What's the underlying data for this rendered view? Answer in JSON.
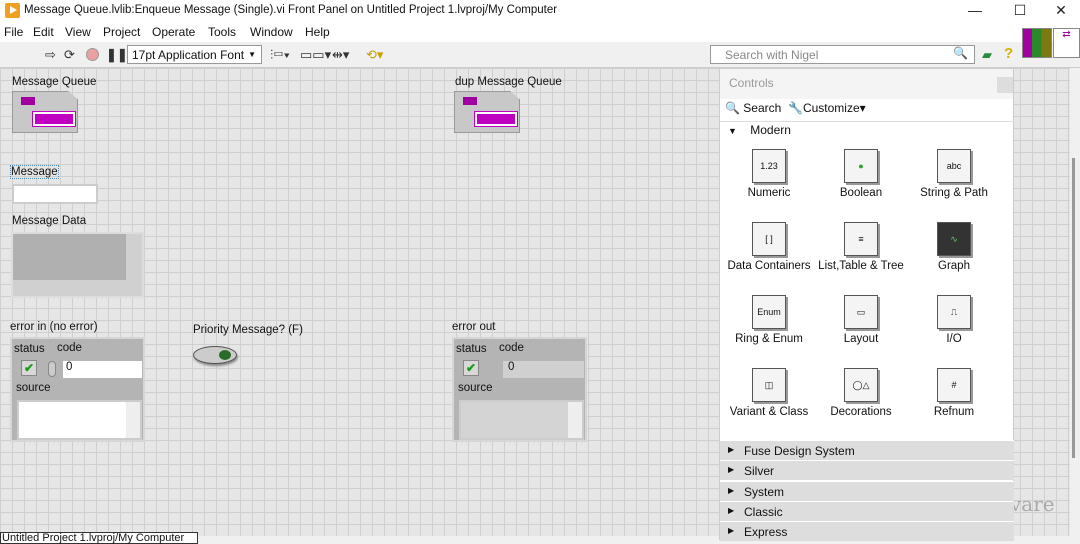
{
  "window": {
    "title": "Message Queue.lvlib:Enqueue Message (Single).vi Front Panel on Untitled Project 1.lvproj/My Computer",
    "minimize": "—",
    "maximize": "☐",
    "close": "✕"
  },
  "menu": [
    "File",
    "Edit",
    "View",
    "Project",
    "Operate",
    "Tools",
    "Window",
    "Help"
  ],
  "toolbar": {
    "font": "17pt Application Font",
    "search_placeholder": "Search with Nigel"
  },
  "panel": {
    "message_queue": "Message Queue",
    "dup_message_queue": "dup Message Queue",
    "message": "Message",
    "message_data": "Message Data",
    "error_in": {
      "label": "error in (no error)",
      "status": "status",
      "code": "code",
      "code_value": "0",
      "source": "source"
    },
    "priority": "Priority Message? (F)",
    "error_out": {
      "label": "error out",
      "status": "status",
      "code": "code",
      "code_value": "0",
      "source": "source"
    }
  },
  "palette": {
    "title": "Controls",
    "search": "Search",
    "customize": "Customize▾",
    "modern": "Modern",
    "items": [
      {
        "label": "Numeric",
        "icon": "1.23"
      },
      {
        "label": "Boolean",
        "icon": "●"
      },
      {
        "label": "String & Path",
        "icon": "abc"
      },
      {
        "label": "Data Containers",
        "icon": "[ ]"
      },
      {
        "label": "List,Table & Tree",
        "icon": "≡"
      },
      {
        "label": "Graph",
        "icon": "∿"
      },
      {
        "label": "Ring & Enum",
        "icon": "Enum"
      },
      {
        "label": "Layout",
        "icon": "▭"
      },
      {
        "label": "I/O",
        "icon": "⎍"
      },
      {
        "label": "Variant & Class",
        "icon": "◫"
      },
      {
        "label": "Decorations",
        "icon": "◯△"
      },
      {
        "label": "Refnum",
        "icon": "#"
      }
    ],
    "categories": [
      "Fuse Design System",
      "Silver",
      "System",
      "Classic",
      "Express"
    ]
  },
  "watermark": "vare",
  "statusbar": "Untitled Project 1.lvproj/My Computer"
}
